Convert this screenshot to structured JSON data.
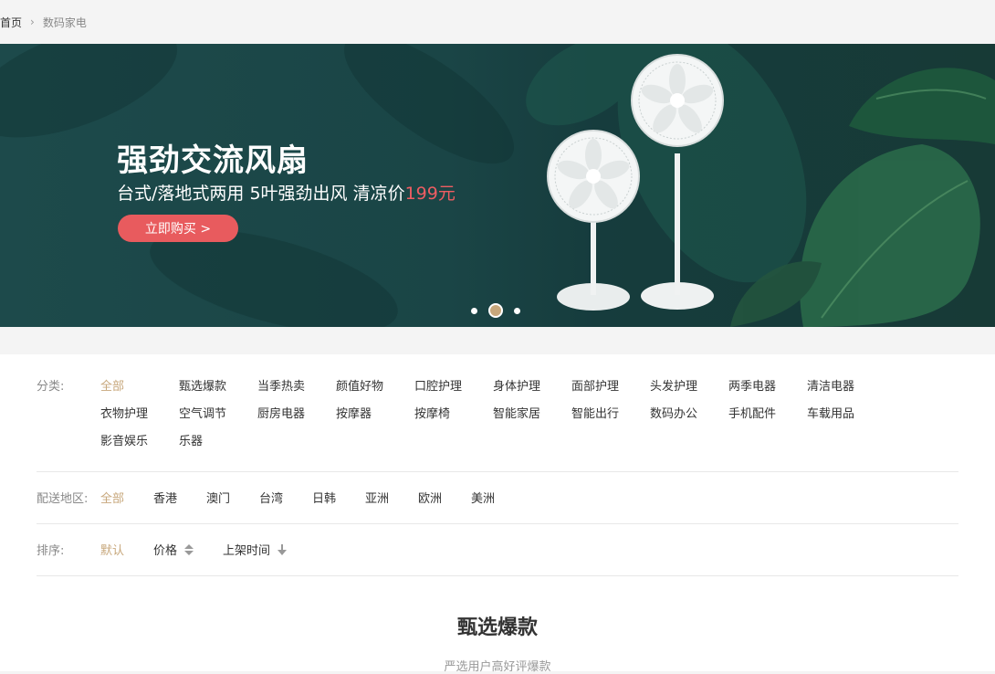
{
  "breadcrumb": {
    "home": "首页",
    "current": "数码家电"
  },
  "banner": {
    "title": "强劲交流风扇",
    "subtitle_text": "台式/落地式两用 5叶强劲出风 清凉价",
    "price": "199元",
    "button": "立即购买 >",
    "dots": 3,
    "active_dot": 1
  },
  "filters": {
    "category_label": "分类:",
    "categories": [
      "全部",
      "甄选爆款",
      "当季热卖",
      "颜值好物",
      "口腔护理",
      "身体护理",
      "面部护理",
      "头发护理",
      "两季电器",
      "清洁电器",
      "衣物护理",
      "空气调节",
      "厨房电器",
      "按摩器",
      "按摩椅",
      "智能家居",
      "智能出行",
      "数码办公",
      "手机配件",
      "车载用品",
      "影音娱乐",
      "乐器"
    ],
    "area_label": "配送地区:",
    "areas": [
      "全部",
      "香港",
      "澳门",
      "台湾",
      "日韩",
      "亚洲",
      "欧洲",
      "美洲"
    ],
    "sort_label": "排序:",
    "sorts": [
      "默认",
      "价格",
      "上架时间"
    ]
  },
  "section": {
    "title": "甄选爆款",
    "subtitle": "严选用户高好评爆款"
  },
  "colors": {
    "accent": "#c7a77b",
    "buy": "#e85b5e",
    "price": "#ee5d62"
  }
}
